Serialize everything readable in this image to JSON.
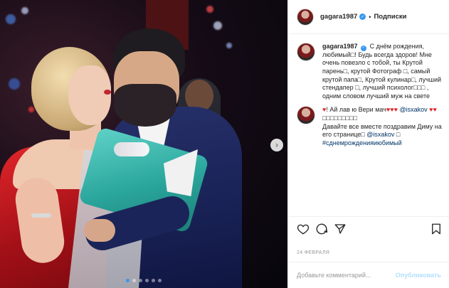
{
  "post": {
    "username": "gagara1987",
    "follow_label": "Подписки",
    "header_sep": "•",
    "verified_mark": "✓",
    "next_arrow": "›",
    "caption": {
      "username": "gagara1987",
      "line1": "С днём рождения, любимый",
      "line2": "! Будь всегда здоров! Мне очень повезло с тобой, ты Крутой парень",
      "line3": ", крутой Фотограф",
      "line4": ", самый крутой папа",
      "line5": ", Крутой кулинар",
      "line6": ", лучший стендапер",
      "line7": ", лучший психолог",
      "line8": " , одним словом лучший муж на свете",
      "line9": "! Ай лав ю Вери мач",
      "line10": "Давайте все вместе поздравим Диму на его странице",
      "mention": "@isxakov",
      "hashtag": "#сднемрожденияцлюбимый"
    },
    "caption_hashtag": "#сднемрожденияиюбимый",
    "second_mention": "@isxakov",
    "date": "24 ФЕВРАЛЯ",
    "add_comment_placeholder": "Добавьте комментарий...",
    "publish_label": "Опубликовать"
  },
  "icons": {
    "like": "heart-icon",
    "comment": "comment-icon",
    "share": "share-icon",
    "save": "bookmark-icon"
  },
  "colors": {
    "link": "#003569",
    "verified": "#3897f0",
    "publish_disabled": "#b2dffc",
    "dress": "#e0262b",
    "bouquet": "#2aa69c"
  },
  "carousel": {
    "total": 6,
    "active": 1
  }
}
